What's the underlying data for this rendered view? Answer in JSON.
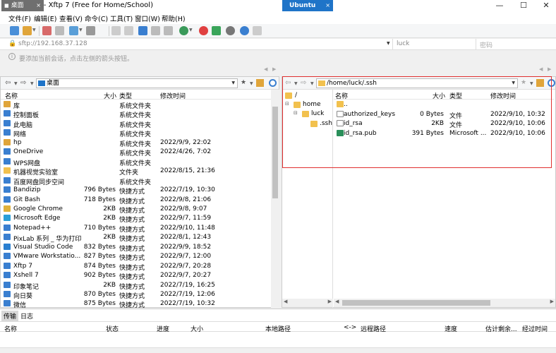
{
  "window": {
    "title": "Ubuntu - Xftp 7 (Free for Home/School)",
    "minimize": "—",
    "maximize": "☐",
    "close": "✕"
  },
  "menu": [
    "文件(F)",
    "编辑(E)",
    "查看(V)",
    "命令(C)",
    "工具(T)",
    "窗口(W)",
    "帮助(H)"
  ],
  "address": {
    "value": "sftp://192.168.37.128",
    "username": "luck",
    "password_placeholder": "密码"
  },
  "infobar": {
    "text": "要添加当前会话，点击左侧的箭头按钮。"
  },
  "tabs": {
    "local": "桌面",
    "remote": "Ubuntu"
  },
  "local": {
    "path": "桌面",
    "columns": {
      "name": "名称",
      "size": "大小",
      "type": "类型",
      "modified": "修改时间"
    },
    "rows": [
      {
        "name": "库",
        "size": "",
        "type": "系统文件夹",
        "modified": "",
        "icon": "library"
      },
      {
        "name": "控制面板",
        "size": "",
        "type": "系统文件夹",
        "modified": "",
        "icon": "control-panel"
      },
      {
        "name": "此电脑",
        "size": "",
        "type": "系统文件夹",
        "modified": "",
        "icon": "computer"
      },
      {
        "name": "网络",
        "size": "",
        "type": "系统文件夹",
        "modified": "",
        "icon": "network"
      },
      {
        "name": "hp",
        "size": "",
        "type": "系统文件夹",
        "modified": "2022/9/9, 22:02",
        "icon": "user-folder"
      },
      {
        "name": "OneDrive",
        "size": "",
        "type": "系统文件夹",
        "modified": "2022/4/26, 7:02",
        "icon": "cloud"
      },
      {
        "name": "WPS网盘",
        "size": "",
        "type": "系统文件夹",
        "modified": "",
        "icon": "cloud"
      },
      {
        "name": "机器视觉实验室",
        "size": "",
        "type": "文件夹",
        "modified": "2022/8/15, 21:36",
        "icon": "folder"
      },
      {
        "name": "百度网盘同步空间",
        "size": "",
        "type": "系统文件夹",
        "modified": "",
        "icon": "cloud"
      },
      {
        "name": "Bandizip",
        "size": "796 Bytes",
        "type": "快捷方式",
        "modified": "2022/7/19, 10:30",
        "icon": "app"
      },
      {
        "name": "Git Bash",
        "size": "718 Bytes",
        "type": "快捷方式",
        "modified": "2022/9/8, 21:06",
        "icon": "app"
      },
      {
        "name": "Google Chrome",
        "size": "2KB",
        "type": "快捷方式",
        "modified": "2022/9/8, 9:07",
        "icon": "chrome"
      },
      {
        "name": "Microsoft Edge",
        "size": "2KB",
        "type": "快捷方式",
        "modified": "2022/9/7, 11:59",
        "icon": "edge"
      },
      {
        "name": "Notepad++",
        "size": "710 Bytes",
        "type": "快捷方式",
        "modified": "2022/9/10, 11:48",
        "icon": "app"
      },
      {
        "name": "PixLab 系列 _ 华为打印",
        "size": "2KB",
        "type": "快捷方式",
        "modified": "2022/8/1, 12:43",
        "icon": "app"
      },
      {
        "name": "Visual Studio Code",
        "size": "832 Bytes",
        "type": "快捷方式",
        "modified": "2022/9/9, 18:52",
        "icon": "vscode"
      },
      {
        "name": "VMware Workstatio...",
        "size": "827 Bytes",
        "type": "快捷方式",
        "modified": "2022/9/7, 12:00",
        "icon": "app"
      },
      {
        "name": "Xftp 7",
        "size": "874 Bytes",
        "type": "快捷方式",
        "modified": "2022/9/7, 20:28",
        "icon": "app"
      },
      {
        "name": "Xshell 7",
        "size": "902 Bytes",
        "type": "快捷方式",
        "modified": "2022/9/7, 20:27",
        "icon": "app"
      },
      {
        "name": "印象笔记",
        "size": "2KB",
        "type": "快捷方式",
        "modified": "2022/7/19, 16:25",
        "icon": "app"
      },
      {
        "name": "向日葵",
        "size": "870 Bytes",
        "type": "快捷方式",
        "modified": "2022/7/19, 12:06",
        "icon": "app"
      },
      {
        "name": "微信",
        "size": "875 Bytes",
        "type": "快捷方式",
        "modified": "2022/7/19, 10:32",
        "icon": "app"
      }
    ]
  },
  "remote": {
    "path": "/home/luck/.ssh",
    "tree": [
      {
        "label": "/",
        "depth": 0
      },
      {
        "label": "home",
        "depth": 1
      },
      {
        "label": "luck",
        "depth": 2
      },
      {
        "label": ".ssh",
        "depth": 3
      }
    ],
    "columns": {
      "name": "名称",
      "size": "大小",
      "type": "类型",
      "modified": "修改时间"
    },
    "rows": [
      {
        "name": "..",
        "size": "",
        "type": "",
        "modified": "",
        "icon": "folder"
      },
      {
        "name": "authorized_keys",
        "size": "0 Bytes",
        "type": "文件",
        "modified": "2022/9/10, 10:32",
        "icon": "file"
      },
      {
        "name": "id_rsa",
        "size": "2KB",
        "type": "文件",
        "modified": "2022/9/10, 10:06",
        "icon": "file"
      },
      {
        "name": "id_rsa.pub",
        "size": "391 Bytes",
        "type": "Microsoft ...",
        "modified": "2022/9/10, 10:06",
        "icon": "pub"
      }
    ]
  },
  "transfer": {
    "tabs": [
      "传输",
      "日志"
    ],
    "columns": [
      "名称",
      "状态",
      "进度",
      "大小",
      "本地路径",
      "<->",
      "远程路径",
      "速度",
      "估计剩余...",
      "经过时间"
    ]
  },
  "colors": {
    "accent": "#1f74c8",
    "highlight": "#e03030",
    "folder": "#f2c14e"
  }
}
